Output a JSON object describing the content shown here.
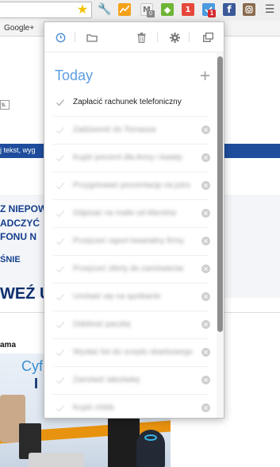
{
  "browser": {
    "bookmarks_bar": {
      "google_plus_label": "Google+"
    },
    "extensions": {
      "gmail_badge": "0",
      "red_extension_label": "1",
      "any_do_badge": "1"
    }
  },
  "background_page": {
    "tag_text": "s.",
    "blue_bar_text": "j tekst, wyg",
    "promo_line1": "Z NIEPOW",
    "promo_line2": "ADCZYĆ",
    "promo_line3": "FONU N",
    "promo_line4": "ŚNIE",
    "promo_big": "WEŹ U",
    "section_label": "ama",
    "ad_text_1": "Cyf",
    "ad_text_2": "I"
  },
  "popup": {
    "section_title": "Today",
    "add_symbol": "+",
    "tasks": [
      {
        "text": "Zapłacić rachunek telefoniczny",
        "blurred": false
      },
      {
        "text": "Zadzwonić do Tomasza",
        "blurred": true
      },
      {
        "text": "Kupić prezent dla Anny i kwiaty",
        "blurred": true
      },
      {
        "text": "Przygotować prezentację na jutro",
        "blurred": true
      },
      {
        "text": "Odpisać na maile od klientów",
        "blurred": true
      },
      {
        "text": "Przejrzeć raport kwartalny firmy",
        "blurred": true
      },
      {
        "text": "Przejrzeć oferty do zamówienia",
        "blurred": true
      },
      {
        "text": "Umówić się na spotkanie",
        "blurred": true
      },
      {
        "text": "Odebrać paczkę",
        "blurred": true
      },
      {
        "text": "Wysłać list do urzędu skarbowego",
        "blurred": true
      },
      {
        "text": "Zamówić taksówkę",
        "blurred": true
      },
      {
        "text": "Kupić chleb",
        "blurred": true
      }
    ]
  },
  "colors": {
    "accent_blue": "#5a9ee2",
    "badge_red": "#d6282c",
    "page_navy": "#143e8c"
  }
}
